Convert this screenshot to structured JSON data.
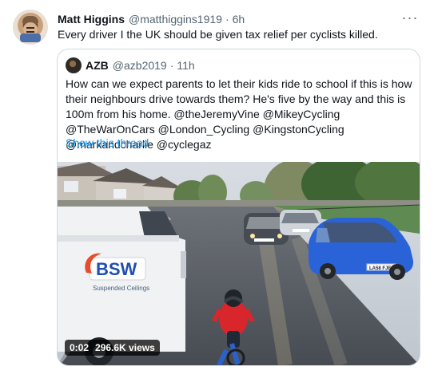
{
  "tweet": {
    "author_name": "Matt Higgins",
    "author_handle": "@matthiggins1919",
    "time_sep": "·",
    "time": "6h",
    "more_label": "···",
    "text": "Every driver I the UK should be given tax relief per cyclists killed."
  },
  "quote": {
    "author_name": "AZB",
    "author_handle": "@azb2019",
    "time_sep": "·",
    "time": "11h",
    "text": "How can we expect parents to let their kids ride to school if this is how their neighbours drive towards them? He's five by the way and this is 100m from his home. @theJeremyVine @MikeyCycling @TheWarOnCars @London_Cycling @KingstonCycling @markandcharlie @cyclegaz",
    "show_thread": "Show this thread"
  },
  "video": {
    "time": "0:02",
    "views": "296.6K views",
    "van_logo_text": "BSW",
    "van_small_text": "Suspended Ceilings",
    "car_plate": "LA58 FJE"
  },
  "colors": {
    "link": "#1d9bf0",
    "text": "#0f1419",
    "secondary": "#536471",
    "border": "#cfd9de"
  },
  "icons": {
    "more": "more-horizontal-icon",
    "avatar": "user-avatar",
    "quote_avatar": "quoted-user-avatar"
  }
}
